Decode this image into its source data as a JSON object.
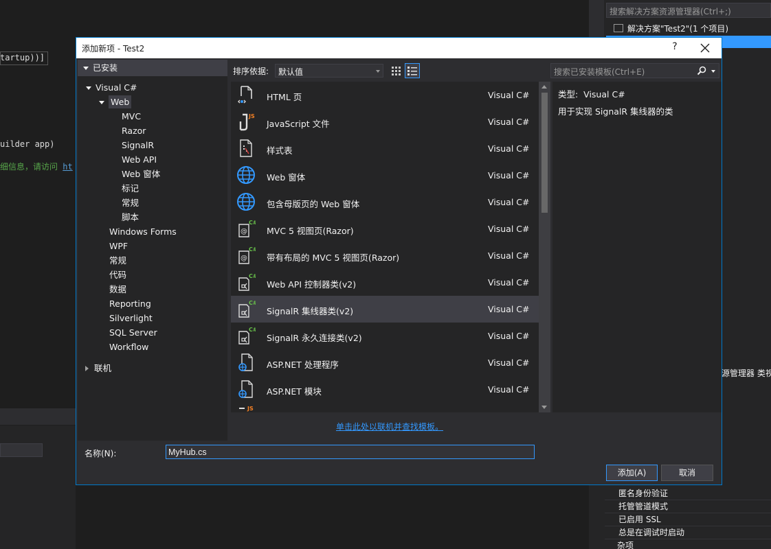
{
  "background": {
    "code_lines": [
      "tartup))]",
      "uilder app)",
      "细信息，请访问 "
    ],
    "code_link": "ht",
    "solution_search_placeholder": "搜索解决方案资源管理器(Ctrl+;)",
    "solution_label": "解决方案\"Test2\"(1 个项目)",
    "panel_tabs": "源管理器  类视",
    "properties": [
      "匿名身份验证",
      "托管管道模式",
      "已启用 SSL",
      "总是在调试时启动",
      "杂项"
    ]
  },
  "dialog": {
    "title": "添加新项 - Test2",
    "help_label": "?",
    "installed_label": "已安装",
    "tree": [
      {
        "label": "Visual C#",
        "indent": 0,
        "expander": "down"
      },
      {
        "label": "Web",
        "indent": 1,
        "expander": "down",
        "selected": true
      },
      {
        "label": "MVC",
        "indent": 2
      },
      {
        "label": "Razor",
        "indent": 2
      },
      {
        "label": "SignalR",
        "indent": 2
      },
      {
        "label": "Web API",
        "indent": 2
      },
      {
        "label": "Web 窗体",
        "indent": 2
      },
      {
        "label": "标记",
        "indent": 2
      },
      {
        "label": "常规",
        "indent": 2
      },
      {
        "label": "脚本",
        "indent": 2
      },
      {
        "label": "Windows Forms",
        "indent": 1
      },
      {
        "label": "WPF",
        "indent": 1
      },
      {
        "label": "常规",
        "indent": 1
      },
      {
        "label": "代码",
        "indent": 1
      },
      {
        "label": "数据",
        "indent": 1
      },
      {
        "label": "Reporting",
        "indent": 1
      },
      {
        "label": "Silverlight",
        "indent": 1
      },
      {
        "label": "SQL Server",
        "indent": 1
      },
      {
        "label": "Workflow",
        "indent": 1
      }
    ],
    "online_label": "联机",
    "sort_label": "排序依据:",
    "sort_value": "默认值",
    "search_placeholder": "搜索已安装模板(Ctrl+E)",
    "items": [
      {
        "name": "HTML 页",
        "lang": "Visual C#",
        "icon": "html-page-icon"
      },
      {
        "name": "JavaScript 文件",
        "lang": "Visual C#",
        "icon": "javascript-file-icon"
      },
      {
        "name": "样式表",
        "lang": "Visual C#",
        "icon": "stylesheet-icon"
      },
      {
        "name": "Web 窗体",
        "lang": "Visual C#",
        "icon": "globe-icon"
      },
      {
        "name": "包含母版页的 Web 窗体",
        "lang": "Visual C#",
        "icon": "globe-icon"
      },
      {
        "name": "MVC 5 视图页(Razor)",
        "lang": "Visual C#",
        "icon": "razor-view-icon"
      },
      {
        "name": "带有布局的 MVC 5 视图页(Razor)",
        "lang": "Visual C#",
        "icon": "razor-view-icon"
      },
      {
        "name": "Web API 控制器类(v2)",
        "lang": "Visual C#",
        "icon": "csharp-class-icon"
      },
      {
        "name": "SignalR 集线器类(v2)",
        "lang": "Visual C#",
        "icon": "csharp-class-icon",
        "selected": true
      },
      {
        "name": "SignalR 永久连接类(v2)",
        "lang": "Visual C#",
        "icon": "csharp-class-icon"
      },
      {
        "name": "ASP.NET 处理程序",
        "lang": "Visual C#",
        "icon": "aspnet-handler-icon"
      },
      {
        "name": "ASP.NET 模块",
        "lang": "Visual C#",
        "icon": "aspnet-module-icon"
      }
    ],
    "detail": {
      "type_label": "类型:",
      "type_value": "Visual C#",
      "description": "用于实现 SignalR 集线器的类"
    },
    "online_link": "单击此处以联机并查找模板。",
    "name_label": "名称(N):",
    "name_value": "MyHub.cs",
    "add_button": "添加(A)",
    "cancel_button": "取消"
  }
}
